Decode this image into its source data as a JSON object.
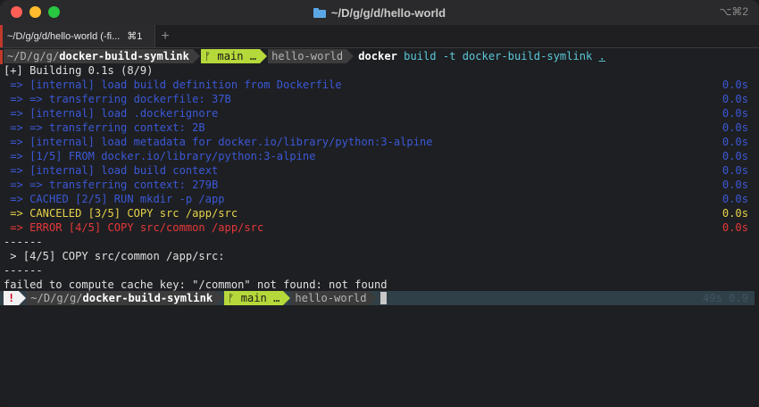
{
  "window": {
    "title": "~/D/g/g/d/hello-world",
    "shortcut": "⌥⌘2",
    "colors": {
      "close": "#ff5f57",
      "minimize": "#febc2e",
      "zoom": "#28c840"
    }
  },
  "tabs": [
    {
      "label": "~/D/g/g/d/hello-world (-fi...",
      "shortcut": "⌘1"
    }
  ],
  "new_tab_label": "+",
  "prompt": {
    "path_prefix": "~/D/g/g/",
    "path_bold": "docker-build-symlink",
    "branch": "ᚠ main …",
    "dir": "hello-world",
    "command": "docker",
    "args": "build -t docker-build-symlink",
    "arg_dot": "."
  },
  "output": {
    "building": "[+] Building 0.1s (8/9)",
    "steps": [
      {
        "text": " => [internal] load build definition from Dockerfile",
        "time": "0.0s",
        "status": "done"
      },
      {
        "text": " => => transferring dockerfile: 37B",
        "time": "0.0s",
        "status": "done"
      },
      {
        "text": " => [internal] load .dockerignore",
        "time": "0.0s",
        "status": "done"
      },
      {
        "text": " => => transferring context: 2B",
        "time": "0.0s",
        "status": "done"
      },
      {
        "text": " => [internal] load metadata for docker.io/library/python:3-alpine",
        "time": "0.0s",
        "status": "done"
      },
      {
        "text": " => [1/5] FROM docker.io/library/python:3-alpine",
        "time": "0.0s",
        "status": "done"
      },
      {
        "text": " => [internal] load build context",
        "time": "0.0s",
        "status": "done"
      },
      {
        "text": " => => transferring context: 279B",
        "time": "0.0s",
        "status": "done"
      },
      {
        "text": " => CACHED [2/5] RUN mkdir -p /app",
        "time": "0.0s",
        "status": "done"
      },
      {
        "text": " => CANCELED [3/5] COPY src /app/src",
        "time": "0.0s",
        "status": "canceled"
      },
      {
        "text": " => ERROR [4/5] COPY src/common /app/src",
        "time": "0.0s",
        "status": "error"
      }
    ],
    "separator1": "------",
    "failed_step": " > [4/5] COPY src/common /app/src:",
    "separator2": "------",
    "error_message": "failed to compute cache key: \"/common\" not found: not found"
  },
  "second_prompt": {
    "status": "!",
    "path_prefix": "~/D/g/g/",
    "path_bold": "docker-build-symlink",
    "branch": "ᚠ main …",
    "dir": "hello-world",
    "ghost_text": "49s 0.9"
  },
  "colors": {
    "step_done": "#3b58d6",
    "step_canceled": "#e6d34a",
    "step_error": "#e5383b",
    "branch_bg": "#b5d93a",
    "command_args": "#5ac8d8"
  }
}
